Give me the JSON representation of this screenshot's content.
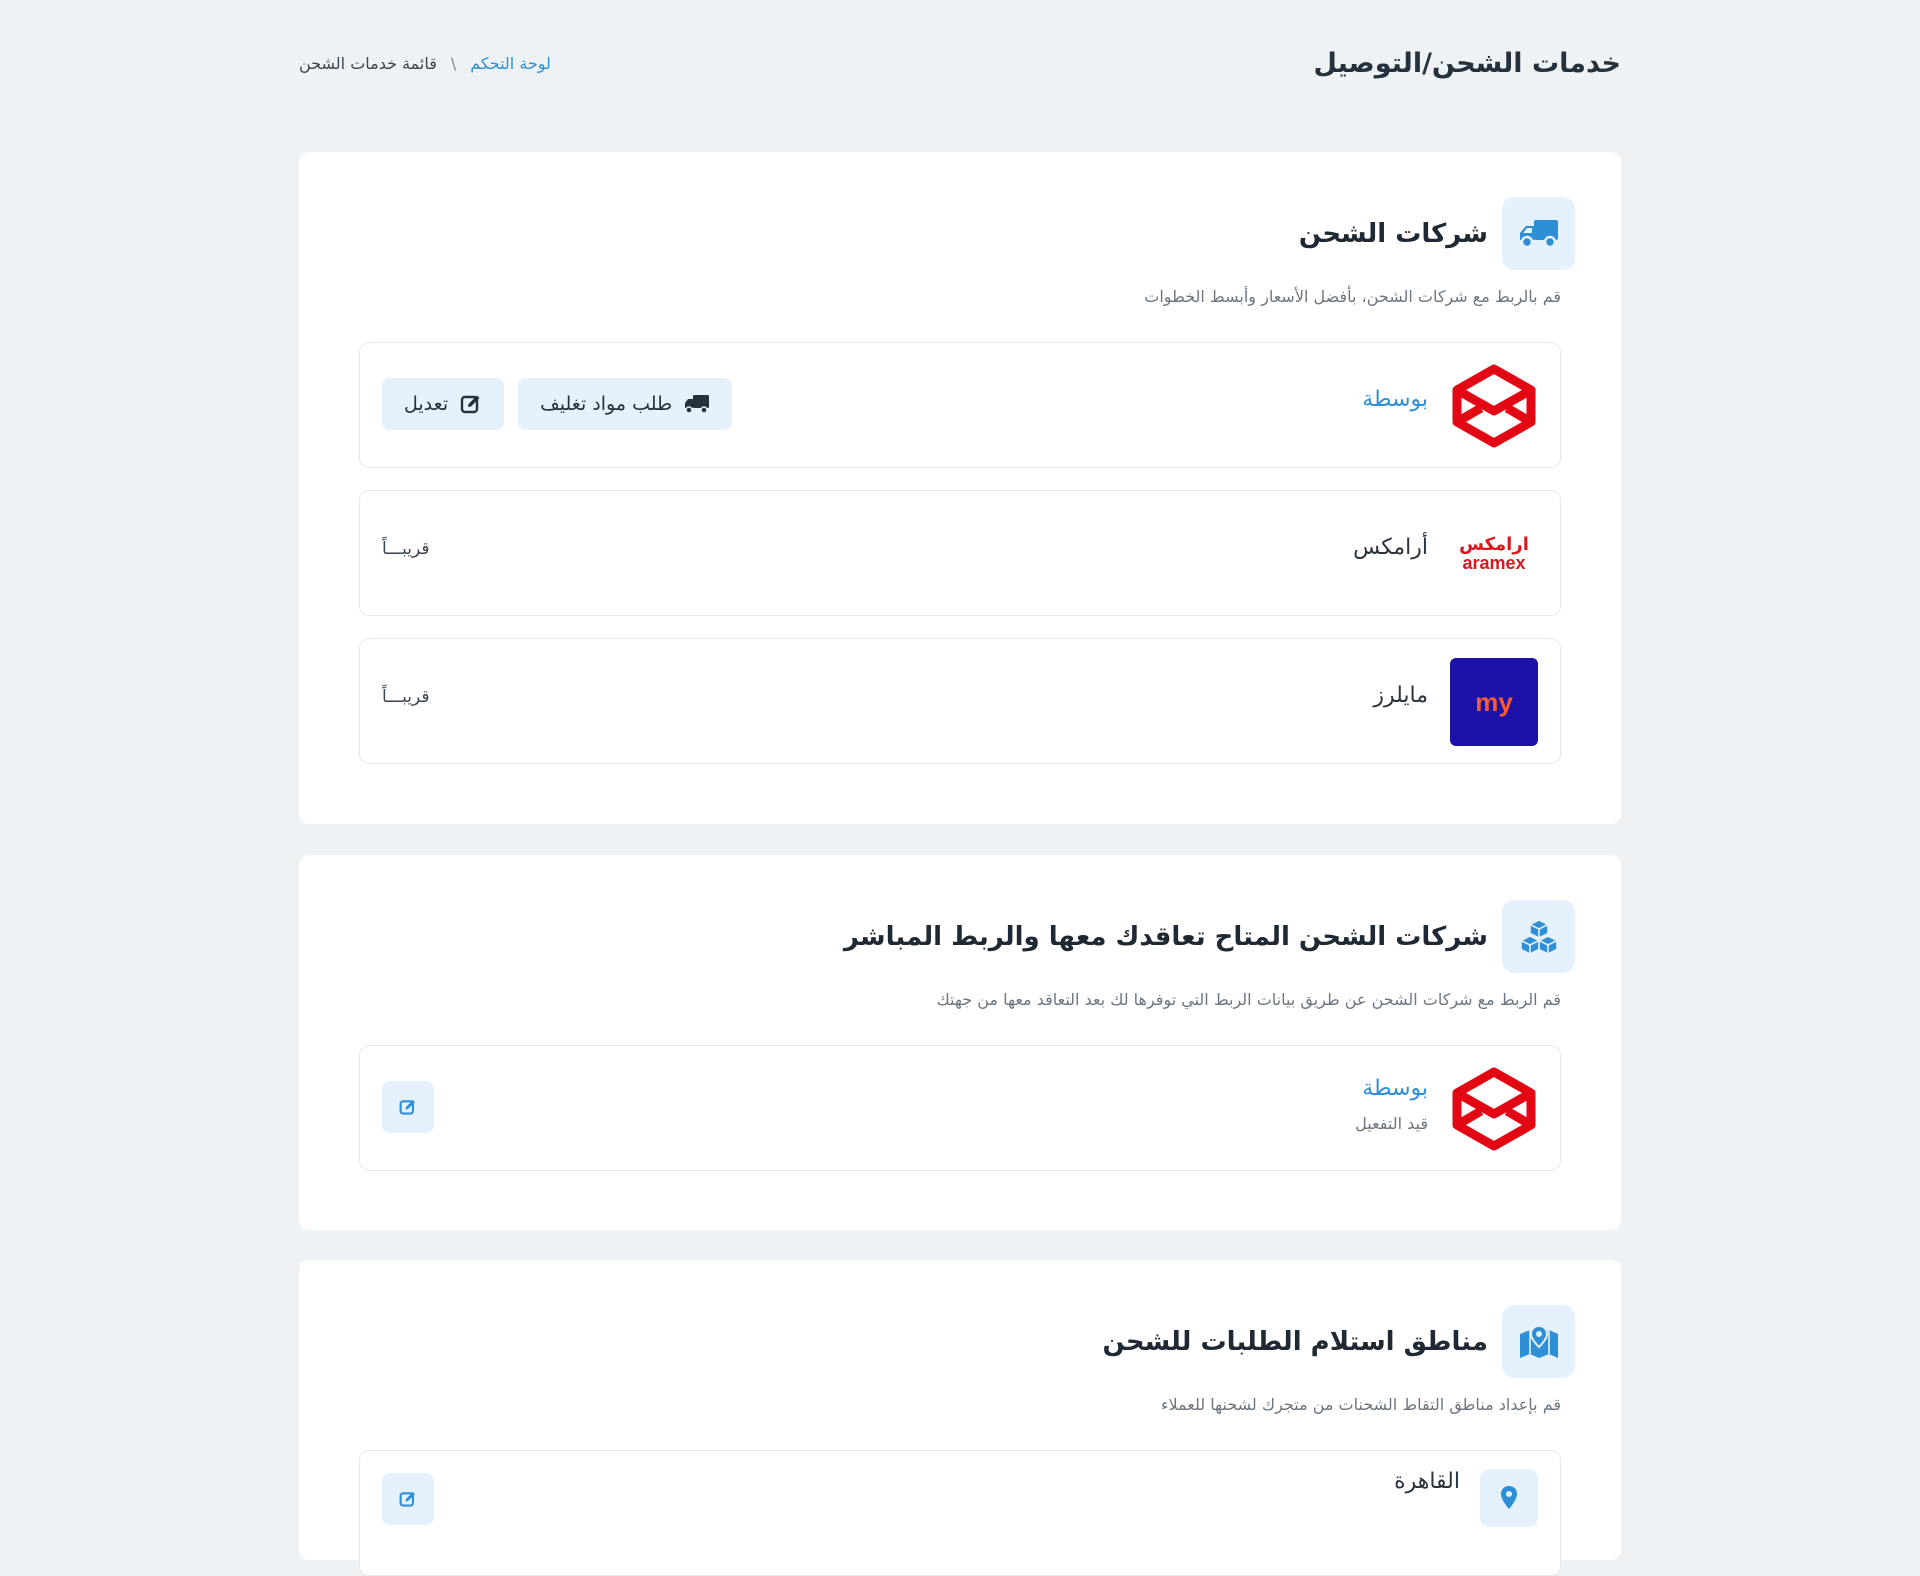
{
  "page": {
    "title": "خدمات الشحن/التوصيل",
    "breadcrumb": {
      "home": "لوحة التحكم",
      "separator": "\\",
      "current": "قائمة خدمات الشحن"
    }
  },
  "colors": {
    "accent": "#2f8fd6",
    "accent_bg": "#e5f2fd",
    "background": "#eef2f5",
    "bosta_red": "#e30613",
    "mylerz_navy": "#1c11a8"
  },
  "shipping_companies": {
    "title": "شركات الشحن",
    "icon": "truck-icon",
    "description": "قم بالربط مع شركات الشحن، بأفضل الأسعار وأبسط الخطوات",
    "items": [
      {
        "name": "بوسطة",
        "logo": "bosta-logo",
        "request_packaging_label": "طلب مواد تغليف",
        "edit_label": "تعديل"
      },
      {
        "name": "أرامكس",
        "logo": "aramex-logo",
        "logo_ar": "ارامكس",
        "logo_en": "aramex",
        "soon_label": "قريبـــاً"
      },
      {
        "name": "مايلرز",
        "logo": "mylerz-logo",
        "logo_text": "my",
        "soon_label": "قريبـــاً"
      }
    ]
  },
  "contract_companies": {
    "title": "شركات الشحن المتاح تعاقدك معها والربط المباشر",
    "icon": "boxes-icon",
    "description": "قم الربط مع شركات الشحن عن طريق بيانات الربط التي توفرها لك بعد التعاقد معها من جهتك",
    "items": [
      {
        "name": "بوسطة",
        "status": "قيد التفعيل",
        "logo": "bosta-logo"
      }
    ]
  },
  "pickup_zones": {
    "title": "مناطق استلام الطلبات للشحن",
    "icon": "map-pin-icon",
    "description": "قم بإعداد مناطق التقاط الشحنات من متجرك لشحنها للعملاء",
    "items": [
      {
        "name": "القاهرة"
      }
    ]
  }
}
